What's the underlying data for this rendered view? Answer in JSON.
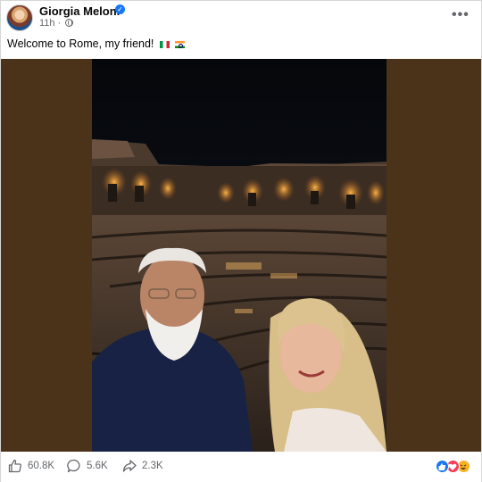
{
  "post": {
    "author": "Giorgia Meloni",
    "time": "11h",
    "caption": "Welcome to Rome, my friend!",
    "flags": [
      "italy-flag",
      "india-flag"
    ]
  },
  "stats": {
    "likes": "60.8K",
    "comments": "5.6K",
    "shares": "2.3K"
  },
  "icons": {
    "verified": "verified-badge-icon",
    "privacy": "globe-icon",
    "more": "more-options-icon",
    "like": "thumbs-up-icon",
    "comment": "comment-bubble-icon",
    "share": "share-arrow-icon",
    "reactions": [
      "like-reaction-icon",
      "love-reaction-icon",
      "haha-reaction-icon"
    ]
  },
  "colors": {
    "media_background": "#4a3319",
    "accent": "#1877f2",
    "secondary_text": "#65676b"
  }
}
